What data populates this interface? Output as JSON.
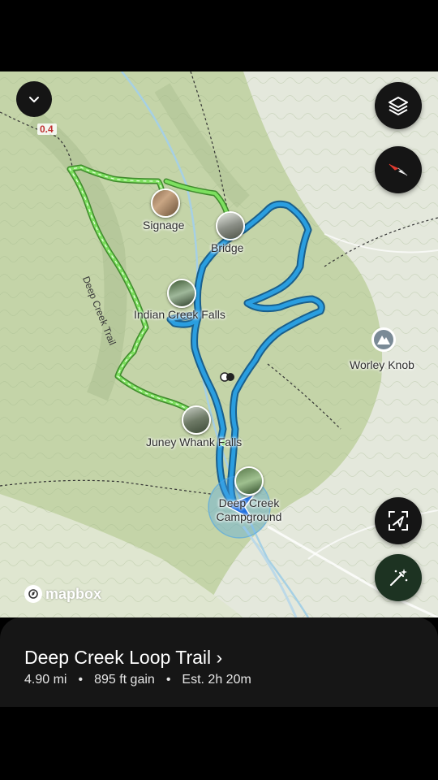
{
  "map": {
    "trail_name_label": "Deep Creek Trail",
    "mileage_marker": "0.4",
    "pois": [
      {
        "label": "Signage",
        "icon": "photo-pin"
      },
      {
        "label": "Bridge",
        "icon": "photo-pin"
      },
      {
        "label": "Indian Creek Falls",
        "icon": "photo-pin"
      },
      {
        "label": "Juney Whank Falls",
        "icon": "photo-pin"
      },
      {
        "label": "Deep Creek Campground",
        "icon": "photo-pin"
      },
      {
        "label": "Worley Knob",
        "icon": "mountain-peak-icon"
      }
    ],
    "attribution": "mapbox",
    "colors": {
      "recorded_track": "#2a8ccf",
      "planned_route": "#6fd35a",
      "terrain": "#b9cc9e"
    }
  },
  "controls": {
    "collapse_icon": "chevron-down-icon",
    "layers_icon": "layers-icon",
    "compass_icon": "compass-icon",
    "recenter_icon": "recenter-icon",
    "magic_icon": "magic-wand-icon"
  },
  "sheet": {
    "title": "Deep Creek Loop Trail ›",
    "distance": "4.90 mi",
    "gain": "895 ft gain",
    "estimate": "Est. 2h 20m"
  }
}
